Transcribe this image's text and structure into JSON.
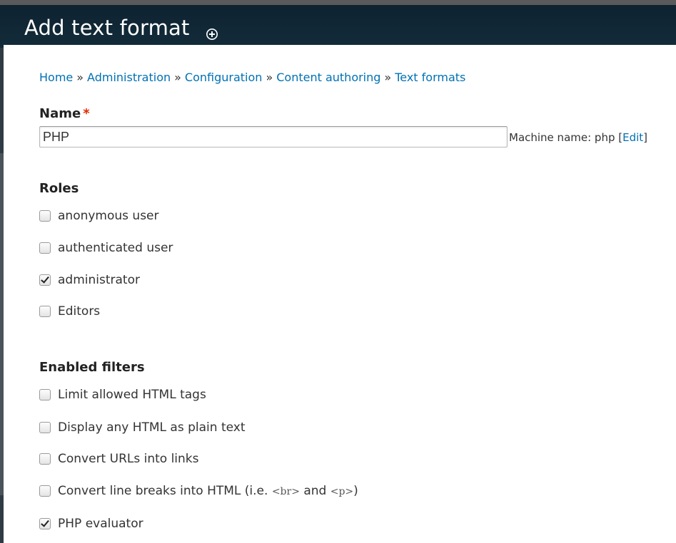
{
  "page": {
    "title": "Add text format"
  },
  "breadcrumb": [
    {
      "label": "Home"
    },
    {
      "label": "Administration"
    },
    {
      "label": "Configuration"
    },
    {
      "label": "Content authoring"
    },
    {
      "label": "Text formats"
    }
  ],
  "breadcrumb_separator": "»",
  "name_field": {
    "label": "Name",
    "required_mark": "*",
    "value": "PHP",
    "machine_name_prefix": "Machine name: php [",
    "machine_name_edit": "Edit",
    "machine_name_suffix": "]"
  },
  "roles": {
    "heading": "Roles",
    "items": [
      {
        "label": "anonymous user",
        "checked": false
      },
      {
        "label": "authenticated user",
        "checked": false
      },
      {
        "label": "administrator",
        "checked": true
      },
      {
        "label": "Editors",
        "checked": false
      }
    ]
  },
  "filters": {
    "heading": "Enabled filters",
    "items": [
      {
        "label": "Limit allowed HTML tags",
        "checked": false
      },
      {
        "label": "Display any HTML as plain text",
        "checked": false
      },
      {
        "label": "Convert URLs into links",
        "checked": false
      },
      {
        "label_before": "Convert line breaks into HTML (i.e. ",
        "code1": "<br>",
        "label_mid": " and ",
        "code2": "<p>",
        "label_after": ")",
        "checked": false
      },
      {
        "label": "PHP evaluator",
        "checked": true
      }
    ]
  },
  "colors": {
    "link": "#0071b3",
    "required": "#e62600",
    "header_bg": "#0e2230"
  },
  "icons": {
    "shortcut": "plus-circle-icon"
  }
}
